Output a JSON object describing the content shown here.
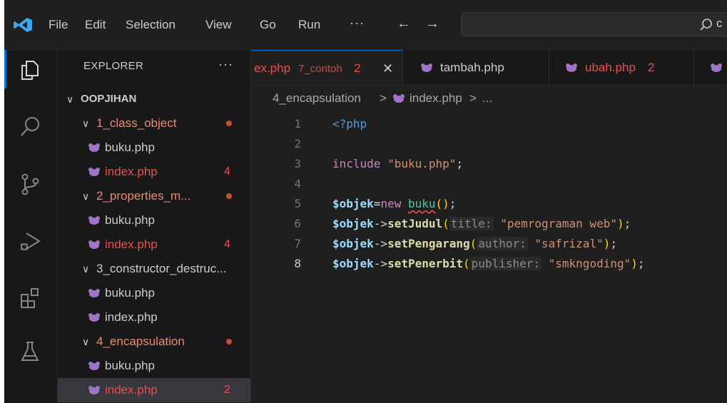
{
  "menubar": {
    "items": [
      "File",
      "Edit",
      "Selection",
      "View",
      "Go",
      "Run"
    ],
    "more": "···",
    "back_arrow": "←",
    "forward_arrow": "→",
    "search_icon": "search-icon",
    "search_partial": "c"
  },
  "activity_bar": {
    "items": [
      "explorer-icon",
      "search-icon",
      "source-control-icon",
      "run-debug-icon",
      "extensions-icon",
      "testing-icon"
    ]
  },
  "explorer": {
    "title": "EXPLORER",
    "more": "···",
    "root": "OOPJIHAN",
    "folders": [
      {
        "name": "1_class_object",
        "modified": true,
        "files": [
          {
            "name": "buku.php",
            "problems": ""
          },
          {
            "name": "index.php",
            "problems": "4"
          }
        ]
      },
      {
        "name": "2_properties_m...",
        "modified": true,
        "files": [
          {
            "name": "buku.php",
            "problems": ""
          },
          {
            "name": "index.php",
            "problems": "4"
          }
        ]
      },
      {
        "name": "3_constructor_destruc...",
        "modified": false,
        "files": [
          {
            "name": "buku.php",
            "problems": ""
          },
          {
            "name": "index.php",
            "problems": ""
          }
        ]
      },
      {
        "name": "4_encapsulation",
        "modified": true,
        "files": [
          {
            "name": "buku.php",
            "problems": ""
          },
          {
            "name": "index.php",
            "problems": "2",
            "selected": true
          }
        ]
      }
    ]
  },
  "tabs": [
    {
      "label": "ex.php",
      "description": "7_contoh",
      "count": "2",
      "close": "✕",
      "active": true
    },
    {
      "label": "tambah.php",
      "description": "",
      "count": ""
    },
    {
      "label": "ubah.php",
      "description": "",
      "count": "2"
    }
  ],
  "breadcrumb": {
    "folder": "4_encapsulation",
    "separator": ">",
    "file": "index.php",
    "tail": "..."
  },
  "code": {
    "current_line": "8",
    "lines": [
      {
        "n": "1",
        "tokens": [
          {
            "t": "<?php",
            "c": "tag"
          }
        ]
      },
      {
        "n": "2",
        "tokens": []
      },
      {
        "n": "3",
        "tokens": [
          {
            "t": "include",
            "c": "kw"
          },
          {
            "t": " ",
            "c": "op"
          },
          {
            "t": "\"buku.php\"",
            "c": "str"
          },
          {
            "t": ";",
            "c": "op"
          }
        ]
      },
      {
        "n": "4",
        "tokens": []
      },
      {
        "n": "5",
        "tokens": [
          {
            "t": "$objek",
            "c": "var"
          },
          {
            "t": "=",
            "c": "op"
          },
          {
            "t": "new",
            "c": "kw"
          },
          {
            "t": " ",
            "c": "op"
          },
          {
            "t": "buku",
            "c": "cls"
          },
          {
            "t": "()",
            "c": "paren"
          },
          {
            "t": ";",
            "c": "op"
          }
        ]
      },
      {
        "n": "6",
        "tokens": [
          {
            "t": "$objek",
            "c": "var"
          },
          {
            "t": "->",
            "c": "op"
          },
          {
            "t": "setJudul",
            "c": "fn"
          },
          {
            "t": "(",
            "c": "paren"
          },
          {
            "t": "title:",
            "c": "hint"
          },
          {
            "t": " ",
            "c": "op"
          },
          {
            "t": "\"pemrograman web\"",
            "c": "str"
          },
          {
            "t": ")",
            "c": "paren"
          },
          {
            "t": ";",
            "c": "op"
          }
        ]
      },
      {
        "n": "7",
        "tokens": [
          {
            "t": "$objek",
            "c": "var"
          },
          {
            "t": "->",
            "c": "op"
          },
          {
            "t": "setPengarang",
            "c": "fn"
          },
          {
            "t": "(",
            "c": "paren"
          },
          {
            "t": "author:",
            "c": "hint"
          },
          {
            "t": " ",
            "c": "op"
          },
          {
            "t": "\"safrizal\"",
            "c": "str"
          },
          {
            "t": ")",
            "c": "paren"
          },
          {
            "t": ";",
            "c": "op"
          }
        ]
      },
      {
        "n": "8",
        "tokens": [
          {
            "t": "$objek",
            "c": "var"
          },
          {
            "t": "->",
            "c": "op"
          },
          {
            "t": "setPenerbit",
            "c": "fn"
          },
          {
            "t": "(",
            "c": "paren"
          },
          {
            "t": "publisher:",
            "c": "hint"
          },
          {
            "t": " ",
            "c": "op"
          },
          {
            "t": "\"smkngoding\"",
            "c": "str"
          },
          {
            "t": ")",
            "c": "paren"
          },
          {
            "t": ";",
            "c": "op"
          }
        ]
      }
    ]
  },
  "colors": {
    "accent": "#0078d4",
    "modified_folder": "#f48771",
    "error_file": "#f14c4c",
    "php_icon": "#a074c4"
  }
}
